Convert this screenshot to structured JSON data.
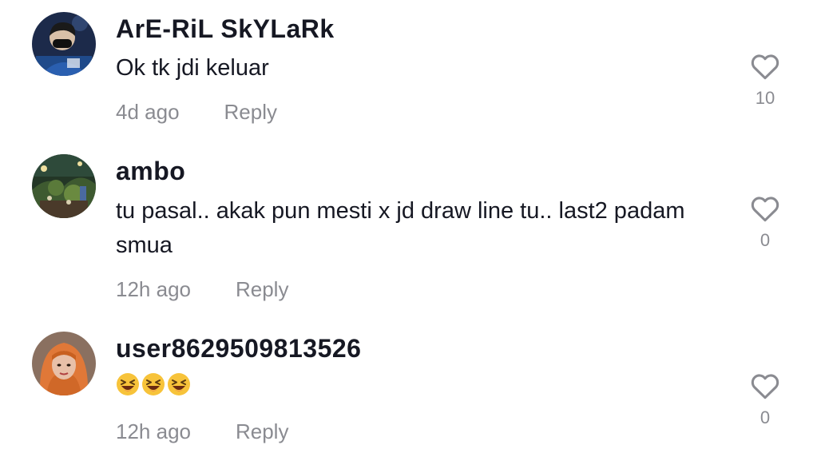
{
  "comments": [
    {
      "username": "ArE-RiL SkYLaRk",
      "text": "Ok tk jdi keluar",
      "time": "4d ago",
      "reply_label": "Reply",
      "likes": "10",
      "avatar_icon": "avatar-masked-man"
    },
    {
      "username": "ambo",
      "text": "tu pasal.. akak pun mesti x jd draw line tu.. last2 padam smua",
      "time": "12h ago",
      "reply_label": "Reply",
      "likes": "0",
      "avatar_icon": "avatar-night-garden"
    },
    {
      "username": "user8629509813526",
      "text": "😆😆😆",
      "time": "12h ago",
      "reply_label": "Reply",
      "likes": "0",
      "avatar_icon": "avatar-woman-orange-hijab"
    }
  ],
  "colors": {
    "text": "#161823",
    "secondary": "#8a8b91",
    "heart_outline": "#8a8b91"
  }
}
